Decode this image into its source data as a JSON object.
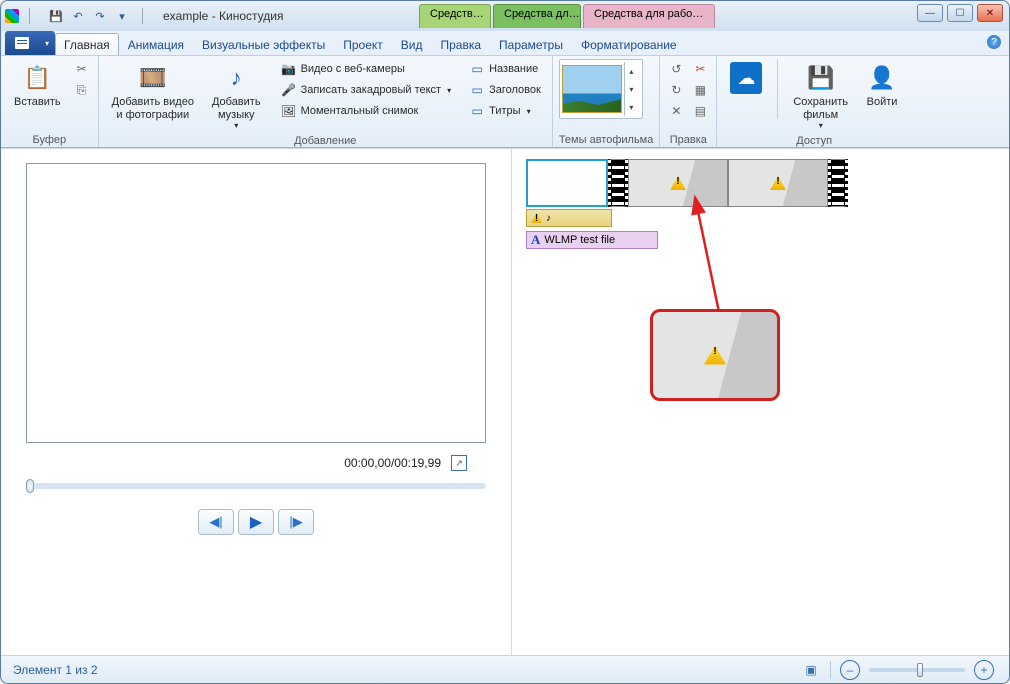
{
  "title": "example - Киностудия",
  "qat": {
    "save": "💾",
    "undo": "↶",
    "redo": "↷",
    "more": "▾"
  },
  "context_tabs": [
    "Средств…",
    "Средства дл…",
    "Средства для рабо…"
  ],
  "window_buttons": {
    "min": "—",
    "max": "☐",
    "close": "✕"
  },
  "file_tab": "",
  "tabs": [
    "Главная",
    "Анимация",
    "Визуальные эффекты",
    "Проект",
    "Вид",
    "Правка",
    "Параметры",
    "Форматирование"
  ],
  "help": "?",
  "ribbon": {
    "clipboard": {
      "paste": "Вставить",
      "cut": "✂",
      "copy": "⎘",
      "label": "Буфер"
    },
    "add": {
      "add_video": "Добавить видео\nи фотографии",
      "add_music": "Добавить\nмузыку",
      "webcam": "Видео с веб-камеры",
      "narration": "Записать закадровый текст",
      "snapshot": "Моментальный снимок",
      "title": "Название",
      "caption": "Заголовок",
      "credits": "Титры",
      "label": "Добавление"
    },
    "themes": {
      "label": "Темы автофильма"
    },
    "edit": {
      "label": "Правка"
    },
    "share": {
      "save_movie": "Сохранить\nфильм",
      "signin": "Войти",
      "label": "Доступ"
    }
  },
  "preview": {
    "time": "00:00,00/00:19,99",
    "prev": "◀|",
    "play": "▶",
    "next": "|▶"
  },
  "timeline": {
    "audio": "♪",
    "text_label": "WLMP test file"
  },
  "status": {
    "text": "Элемент 1 из 2",
    "views": "▣",
    "zoom_out": "–",
    "zoom_in": "+"
  }
}
